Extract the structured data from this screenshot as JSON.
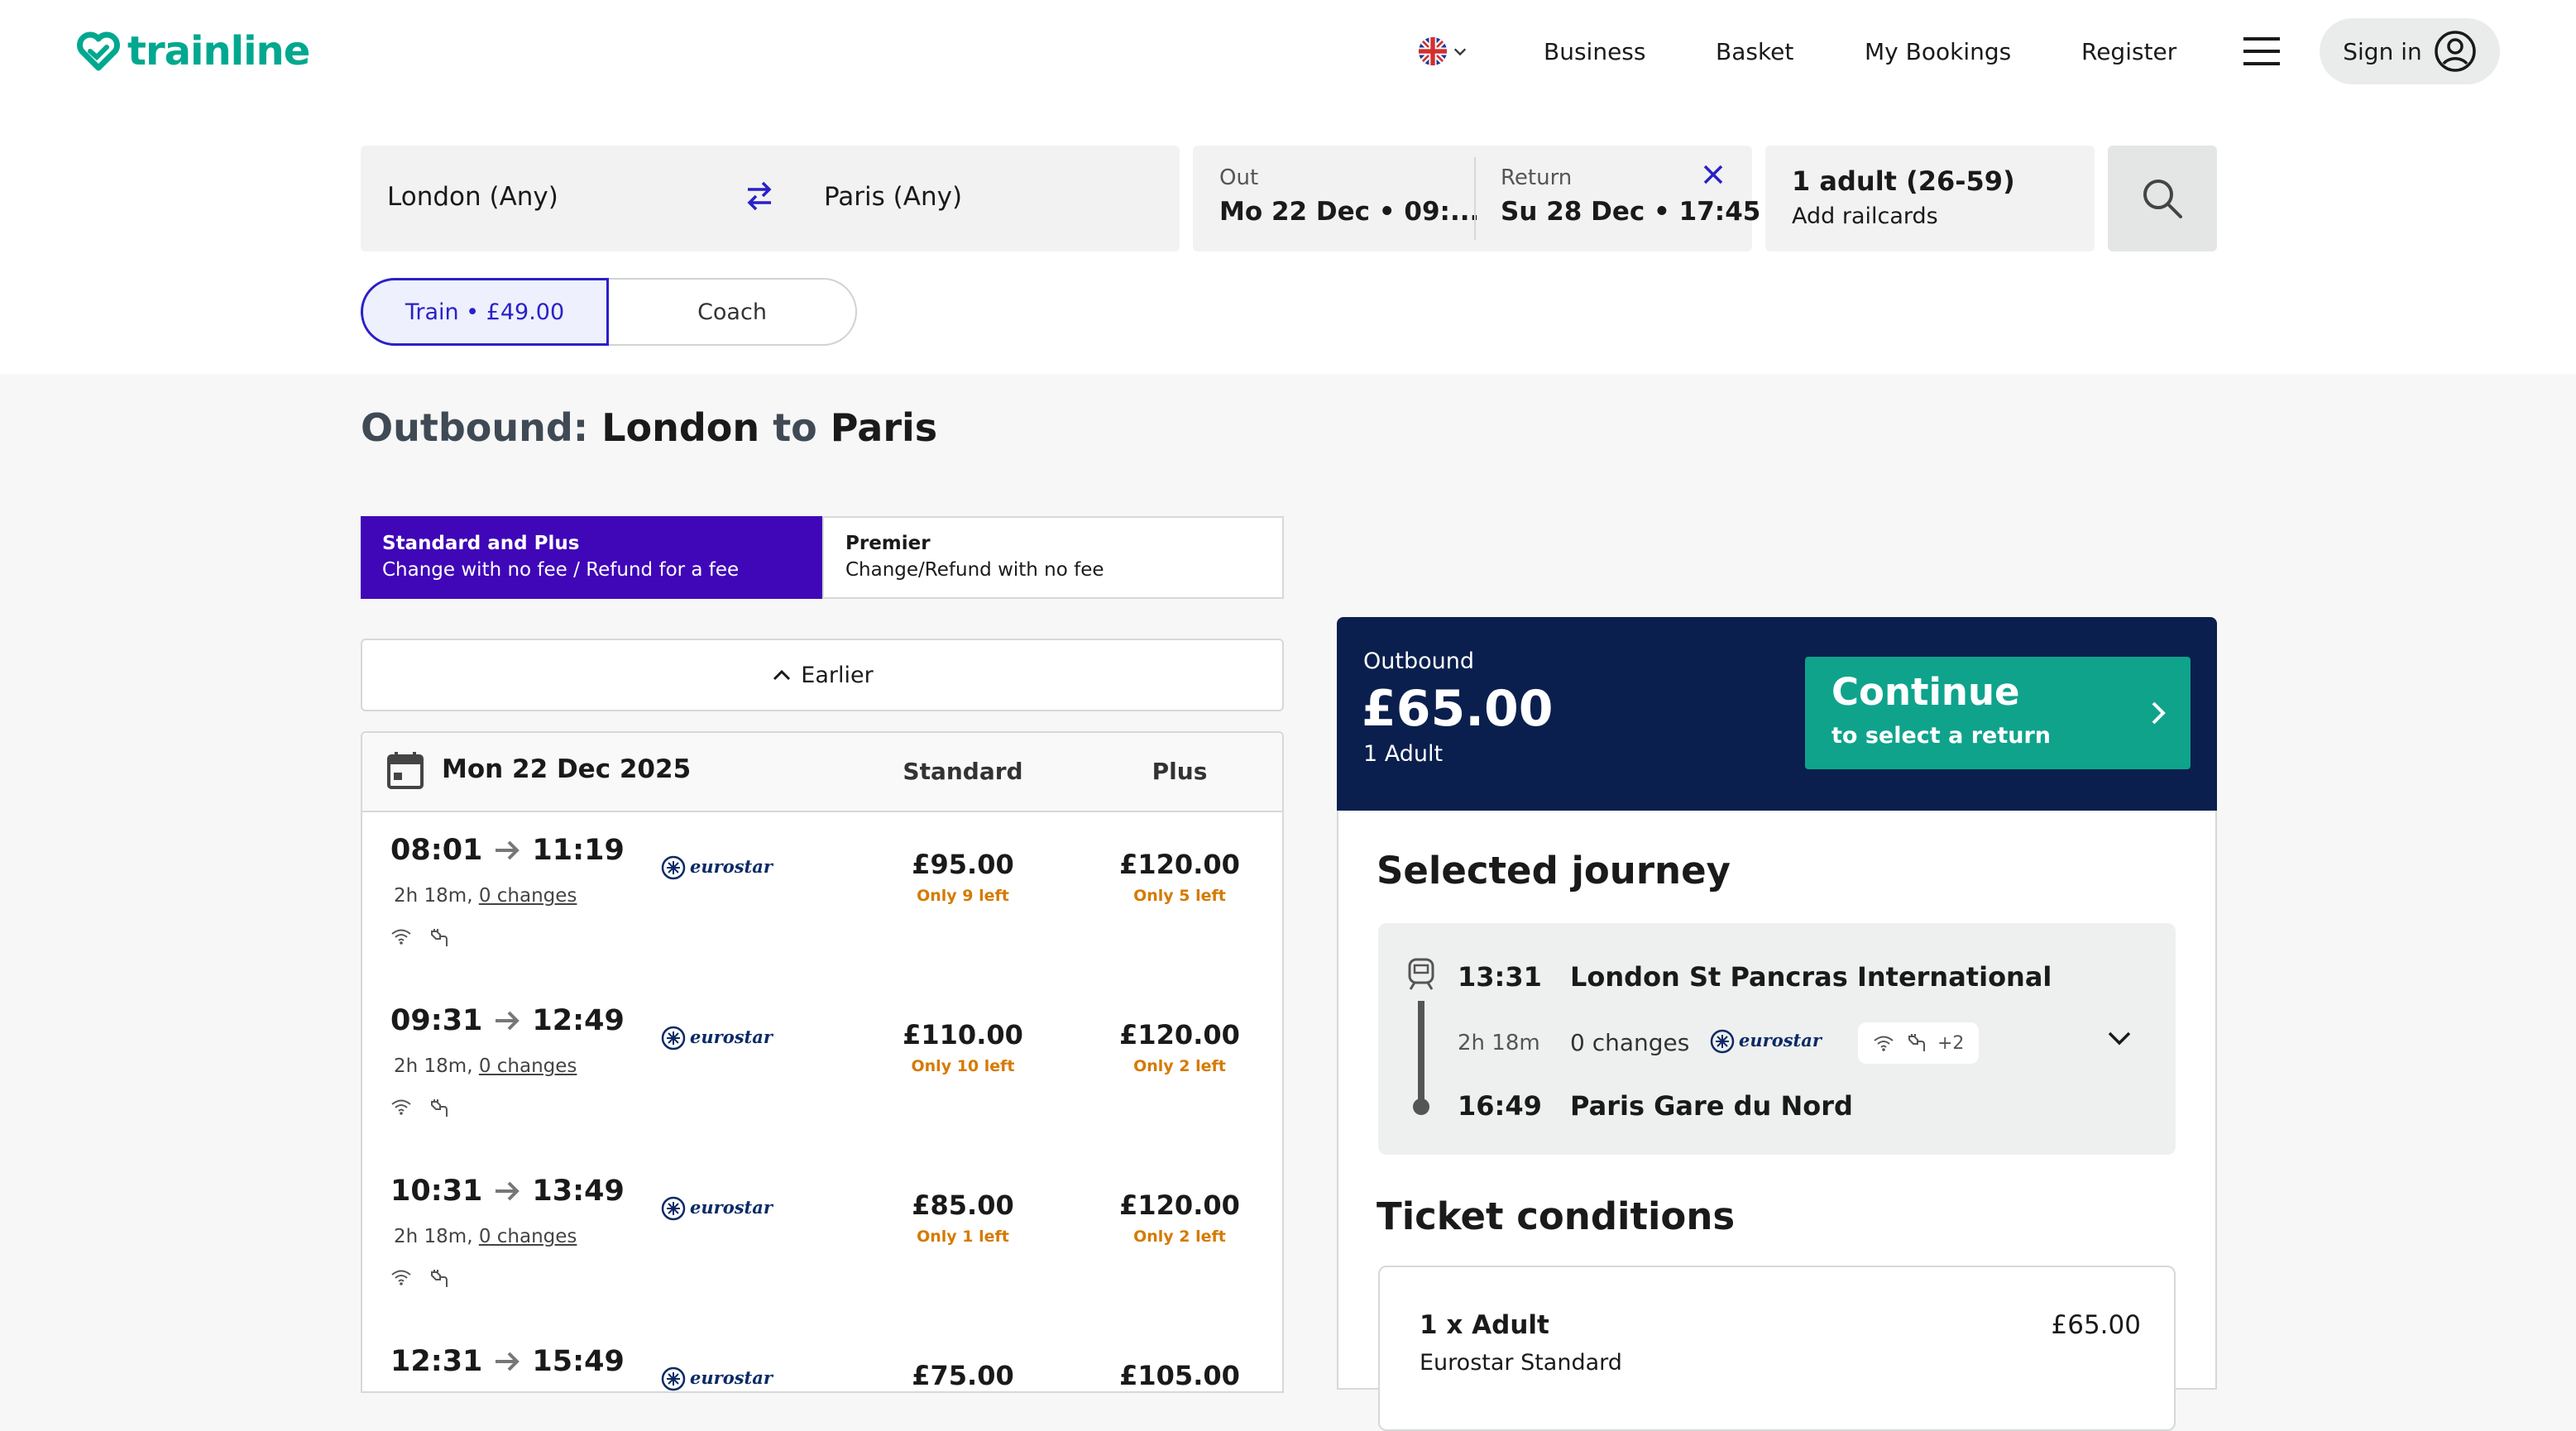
{
  "header": {
    "logo_text": "trainline",
    "nav": [
      "Business",
      "Basket",
      "My Bookings",
      "Register"
    ],
    "signin": "Sign in",
    "brand_color": "#00a88f"
  },
  "search": {
    "from": "London (Any)",
    "to": "Paris (Any)",
    "out_label": "Out",
    "out_value": "Mo 22 Dec • 09:...",
    "return_label": "Return",
    "return_value": "Su 28 Dec • 17:45",
    "passengers": "1 adult (26-59)",
    "railcards": "Add railcards"
  },
  "modes": {
    "train": "Train • £49.00",
    "coach": "Coach"
  },
  "heading": {
    "prefix": "Outbound:",
    "from": "London",
    "to_word": "to",
    "to": "Paris"
  },
  "fare_tabs": [
    {
      "title": "Standard and Plus",
      "subtitle": "Change with no fee / Refund for a fee"
    },
    {
      "title": "Premier",
      "subtitle": "Change/Refund with no fee"
    }
  ],
  "earlier": "Earlier",
  "results": {
    "date": "Mon 22 Dec 2025",
    "col_standard": "Standard",
    "col_plus": "Plus",
    "operator": "eurostar",
    "rows": [
      {
        "dep": "08:01",
        "arr": "11:19",
        "duration": "2h 18m,",
        "changes": "0 changes",
        "std_price": "£95.00",
        "std_left": "Only 9 left",
        "plus_price": "£120.00",
        "plus_left": "Only 5 left"
      },
      {
        "dep": "09:31",
        "arr": "12:49",
        "duration": "2h 18m,",
        "changes": "0 changes",
        "std_price": "£110.00",
        "std_left": "Only 10 left",
        "plus_price": "£120.00",
        "plus_left": "Only 2 left"
      },
      {
        "dep": "10:31",
        "arr": "13:49",
        "duration": "2h 18m,",
        "changes": "0 changes",
        "std_price": "£85.00",
        "std_left": "Only 1 left",
        "plus_price": "£120.00",
        "plus_left": "Only 2 left"
      },
      {
        "dep": "12:31",
        "arr": "15:49",
        "duration": "",
        "changes": "",
        "std_price": "£75.00",
        "std_left": "",
        "plus_price": "£105.00",
        "plus_left": ""
      }
    ]
  },
  "summary": {
    "label": "Outbound",
    "price": "£65.00",
    "passengers": "1 Adult",
    "continue_title": "Continue",
    "continue_sub": "to select a return"
  },
  "selected": {
    "title": "Selected journey",
    "dep_time": "13:31",
    "dep_station": "London St Pancras International",
    "duration": "2h 18m",
    "changes": "0 changes",
    "extra_amenities": "+2",
    "arr_time": "16:49",
    "arr_station": "Paris Gare du Nord"
  },
  "conditions": {
    "title": "Ticket conditions",
    "passenger": "1 x Adult",
    "price": "£65.00",
    "ticket": "Eurostar Standard"
  }
}
